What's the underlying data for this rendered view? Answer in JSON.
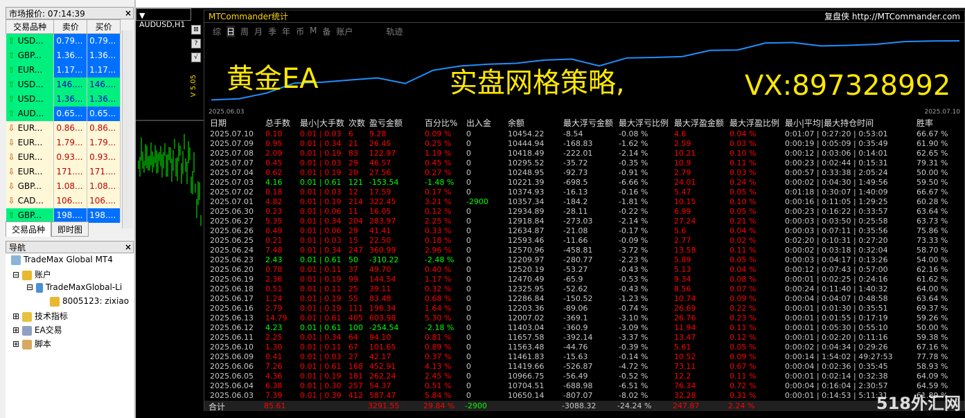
{
  "market_watch": {
    "title": "市场报价: 07:14:39",
    "headers": [
      "交易品种",
      "卖价",
      "买价"
    ],
    "rows": [
      {
        "dir": "up",
        "sym": "USD...",
        "bid": "0.79...",
        "ask": "0.79..."
      },
      {
        "dir": "up",
        "sym": "GBP...",
        "bid": "1.36...",
        "ask": "1.36..."
      },
      {
        "dir": "up",
        "sym": "EUR...",
        "bid": "1.17...",
        "ask": "1.17..."
      },
      {
        "dir": "up",
        "sym": "USD...",
        "bid": "146....",
        "ask": "146...."
      },
      {
        "dir": "up",
        "sym": "USD...",
        "bid": "1.36...",
        "ask": "1.36..."
      },
      {
        "dir": "up",
        "sym": "AUD...",
        "bid": "0.65...",
        "ask": "0.65..."
      },
      {
        "dir": "dn",
        "sym": "EUR...",
        "bid": "0.86...",
        "ask": "0.86..."
      },
      {
        "dir": "dn",
        "sym": "EUR...",
        "bid": "1.79...",
        "ask": "1.79..."
      },
      {
        "dir": "dn",
        "sym": "EUR...",
        "bid": "0.93...",
        "ask": "0.93..."
      },
      {
        "dir": "dn",
        "sym": "EUR...",
        "bid": "171....",
        "ask": "171...."
      },
      {
        "dir": "dn",
        "sym": "GBP...",
        "bid": "1.08...",
        "ask": "1.08..."
      },
      {
        "dir": "dn",
        "sym": "CAD...",
        "bid": "106....",
        "ask": "106...."
      },
      {
        "dir": "up",
        "sym": "GBP...",
        "bid": "198....",
        "ask": "198...."
      }
    ],
    "tabs": [
      "交易品种",
      "即时图"
    ]
  },
  "navigator": {
    "title": "导航",
    "root": "TradeMax Global MT4",
    "accounts": "账户",
    "server": "TradeMaxGlobal-Li",
    "account": "8005123: zixiao",
    "indicators": "技术指标",
    "ea": "EA交易",
    "scripts": "脚本"
  },
  "chart_tab": "AUDUSD,H1",
  "side_label": "V 5.05",
  "panel": {
    "title": "MTCommander统计",
    "brand": "复盘侠",
    "url": "http://MTCommander.com",
    "tabs": [
      "综",
      "日",
      "周",
      "月",
      "季",
      "年",
      "币",
      "M",
      "备",
      "账户",
      "轨迹"
    ],
    "overlay1": "黄金EA",
    "overlay2": "实盘网格策略,",
    "overlay3": "VX:897328992",
    "date_start": "2025.06.03",
    "date_end": "2025.07.10",
    "headers": [
      "日期",
      "总手数",
      "最小|大手数",
      "次数",
      "盈亏金额",
      "百分比%",
      "出入金",
      "余额",
      "最大浮亏金额",
      "最大浮亏比例",
      "最大浮盈金额",
      "最大浮盈比例",
      "最小|平均|最大持仓时间",
      "胜率"
    ],
    "rows": [
      [
        "2025.07.10",
        "0.10",
        "0.01 | 0.03",
        "6",
        "9.28",
        "0.09 %",
        "0",
        "10454.22",
        "-8.54",
        "-0.08 %",
        "4.6",
        "0.04 %",
        "0:01:07 | 0:27:20 | 0:53:01",
        "66.67 %"
      ],
      [
        "2025.07.09",
        "0.95",
        "0.01 | 0.34",
        "21",
        "26.45",
        "0.25 %",
        "0",
        "10444.94",
        "-168.83",
        "-1.62 %",
        "2.59",
        "0.03 %",
        "0:00:19 | 0:05:09 | 0:35:49",
        "61.90 %"
      ],
      [
        "2025.07.08",
        "2.09",
        "0.01 | 0.19",
        "83",
        "122.97",
        "1.19 %",
        "0",
        "10418.49",
        "-222.01",
        "-2.14 %",
        "10.21",
        "0.10 %",
        "0:00:12 | 0:03:06 | 0:14:01",
        "62.65 %"
      ],
      [
        "2025.07.07",
        "0.45",
        "0.01 | 0.03",
        "29",
        "46.57",
        "0.45 %",
        "0",
        "10295.52",
        "-35.72",
        "-0.35 %",
        "10.9",
        "0.11 %",
        "0:00:23 | 0:02:44 | 0:15:31",
        "79.31 %"
      ],
      [
        "2025.07.04",
        "0.62",
        "0.01 | 0.19",
        "20",
        "27.56",
        "0.27 %",
        "0",
        "10248.95",
        "-92.73",
        "-0.91 %",
        "2.79",
        "0.03 %",
        "0:00:57 | 0:33:38 | 2:05:24",
        "50.00 %"
      ],
      [
        "2025.07.03",
        "4.16",
        "0.01 | 0.61",
        "121",
        "-153.54",
        "-1.48 %",
        "0",
        "10221.39",
        "-698.5",
        "-6.66 %",
        "24.01",
        "0.24 %",
        "0:00:02 | 0:04:30 | 1:49:56",
        "59.50 %"
      ],
      [
        "2025.07.02",
        "0.18",
        "0.01 | 0.03",
        "12",
        "17.59",
        "0.17 %",
        "0",
        "10374.93",
        "-16.13",
        "-0.16 %",
        "5.47",
        "0.05 %",
        "0:01:18 | 0:30:07 | 1:40:09",
        "66.67 %"
      ],
      [
        "2025.07.01",
        "4.82",
        "0.01 | 0.19",
        "214",
        "322.45",
        "3.21 %",
        "-2900",
        "10357.34",
        "-184.2",
        "-1.81 %",
        "10.15",
        "0.10 %",
        "0:00:16 | 0:11:05 | 1:29:25",
        "60.28 %"
      ],
      [
        "2025.06.30",
        "0.23",
        "0.01 | 0.06",
        "11",
        "16.05",
        "0.12 %",
        "0",
        "12934.89",
        "-28.11",
        "-0.22 %",
        "6.99",
        "0.05 %",
        "0:00:23 | 0:16:22 | 0:33:57",
        "63.64 %"
      ],
      [
        "2025.06.27",
        "5.35",
        "0.01 | 0.34",
        "204",
        "283.97",
        "2.25 %",
        "0",
        "12918.84",
        "-273.03",
        "-2.14 %",
        "27.24",
        "0.21 %",
        "0:00:03 | 0:03:50 | 0:25:58",
        "63.73 %"
      ],
      [
        "2025.06.26",
        "0.49",
        "0.01 | 0.06",
        "29",
        "41.41",
        "0.33 %",
        "0",
        "12634.87",
        "-21.08",
        "-0.17 %",
        "5.6",
        "0.04 %",
        "0:00:03 | 0:07:11 | 0:35:56",
        "75.86 %"
      ],
      [
        "2025.06.25",
        "0.21",
        "0.01 | 0.03",
        "15",
        "22.50",
        "0.18 %",
        "0",
        "12593.46",
        "-11.66",
        "-0.09 %",
        "2.77",
        "0.02 %",
        "0:02:20 | 0:10:31 | 0:27:20",
        "73.33 %"
      ],
      [
        "2025.06.24",
        "7.48",
        "0.01 | 0.34",
        "247",
        "360.99",
        "2.96 %",
        "0",
        "12570.96",
        "-458.81",
        "-3.72 %",
        "13.58",
        "0.11 %",
        "0:00:02 | 0:03:18 | 0:32:04",
        "58.70 %"
      ],
      [
        "2025.06.23",
        "2.43",
        "0.01 | 0.61",
        "50",
        "-310.22",
        "-2.48 %",
        "0",
        "12209.97",
        "-280.77",
        "-2.23 %",
        "5.89",
        "0.05 %",
        "0:00:03 | 0:04:17 | 0:13:26",
        "54.00 %"
      ],
      [
        "2025.06.20",
        "0.78",
        "0.01 | 0.11",
        "37",
        "49.70",
        "0.40 %",
        "0",
        "12520.19",
        "-53.27",
        "-0.43 %",
        "5.13",
        "0.04 %",
        "0:00:12 | 0:07:43 | 0:57:00",
        "62.16 %"
      ],
      [
        "2025.06.19",
        "2.36",
        "0.01 | 0.19",
        "99",
        "144.54",
        "1.17 %",
        "0",
        "12470.49",
        "-65.9",
        "-0.53 %",
        "9.34",
        "0.08 %",
        "0:00:01 | 0:02:25 | 0:24:16",
        "61.62 %"
      ],
      [
        "2025.06.18",
        "0.51",
        "0.01 | 0.11",
        "25",
        "39.11",
        "0.32 %",
        "0",
        "12325.95",
        "-52.62",
        "-0.43 %",
        "8.56",
        "0.07 %",
        "0:00:24 | 0:11:40 | 1:40:32",
        "64.00 %"
      ],
      [
        "2025.06.17",
        "1.24",
        "0.01 | 0.19",
        "55",
        "83.48",
        "0.68 %",
        "0",
        "12286.84",
        "-150.52",
        "-1.23 %",
        "10.74",
        "0.09 %",
        "0:00:04 | 0:04:07 | 0:48:58",
        "63.64 %"
      ],
      [
        "2025.06.16",
        "2.79",
        "0.01 | 0.19",
        "111",
        "196.34",
        "1.64 %",
        "0",
        "12203.36",
        "-89.06",
        "-0.74 %",
        "26.69",
        "0.22 %",
        "0:00:01 | 0:01:30 | 0:35:51",
        "69.37 %"
      ],
      [
        "2025.06.13",
        "14.79",
        "0.01 | 0.61",
        "405",
        "603.98",
        "5.30 %",
        "0",
        "12007.02",
        "-369.1",
        "-3.10 %",
        "26.76",
        "0.23 %",
        "0:00:01 | 0:01:55 | 0:17:19",
        "59.26 %"
      ],
      [
        "2025.06.12",
        "4.23",
        "0.01 | 0.61",
        "100",
        "-254.54",
        "-2.18 %",
        "0",
        "11403.04",
        "-360.9",
        "-3.09 %",
        "11.94",
        "0.11 %",
        "0:00:01 | 0:05:30 | 0:55:10",
        "50.00 %"
      ],
      [
        "2025.06.11",
        "2.25",
        "0.01 | 0.34",
        "64",
        "94.10",
        "0.81 %",
        "0",
        "11657.58",
        "-392.14",
        "-3.37 %",
        "13.47",
        "0.12 %",
        "0:00:01 | 0:02:20 | 0:11:16",
        "59.38 %"
      ],
      [
        "2025.06.10",
        "1.30",
        "0.01 | 0.11",
        "67",
        "101.65",
        "0.89 %",
        "0",
        "11563.48",
        "-44.76",
        "-0.39 %",
        "5.61",
        "0.05 %",
        "0:00:02 | 0:04:34 | 0:29:26",
        "67.16 %"
      ],
      [
        "2025.06.09",
        "0.41",
        "0.01 | 0.03",
        "27",
        "42.17",
        "0.37 %",
        "0",
        "11461.83",
        "-15.63",
        "-0.14 %",
        "10.52",
        "0.09 %",
        "0:00:14 | 1:54:02 | 49:27:53",
        "77.78 %"
      ],
      [
        "2025.06.06",
        "7.26",
        "0.01 | 0.61",
        "168",
        "452.91",
        "4.13 %",
        "0",
        "11419.66",
        "-526.87",
        "-4.72 %",
        "73.11",
        "0.67 %",
        "0:00:04 | 0:02:36 | 0:35:45",
        "58.93 %"
      ],
      [
        "2025.06.05",
        "4.36",
        "0.01 | 0.19",
        "181",
        "262.24",
        "2.45 %",
        "0",
        "10966.75",
        "-56.49",
        "-0.52 %",
        "12.2",
        "0.11 %",
        "0:00:01 | 0:02:14 | 0:32:38",
        "64.09 %"
      ],
      [
        "2025.06.04",
        "6.38",
        "0.01 | 0.30",
        "257",
        "54.37",
        "0.51 %",
        "0",
        "10704.51",
        "-688.98",
        "-6.51 %",
        "76.34",
        "0.72 %",
        "0:00:04 | 0:16:04 | 2:30:57",
        "64.59 %"
      ],
      [
        "2025.06.03",
        "7.39",
        "0.01 | 0.39",
        "412",
        "587.47",
        "5.84 %",
        "0",
        "10650.14",
        "-807.07",
        "-8.02 %",
        "32.28",
        "0.31 %",
        "0:00:01 | 0:14:53 | 5:11:31",
        "61.89 %"
      ]
    ],
    "total": {
      "label": "合计",
      "lots": "85.61",
      "pnl": "3291.55",
      "pct": "29.84 %",
      "flow": "-2900",
      "maxloss": "-3088.32",
      "maxlosspct": "-24.24 %",
      "maxgain": "247.87",
      "maxgainpct": "2.24 %"
    }
  },
  "watermark": "518外汇网",
  "colors": {
    "accent_yellow": "#ffd800",
    "loss_red": "#ff0000",
    "gain_green": "#00ff00",
    "equity_line": "#1e90ff"
  }
}
